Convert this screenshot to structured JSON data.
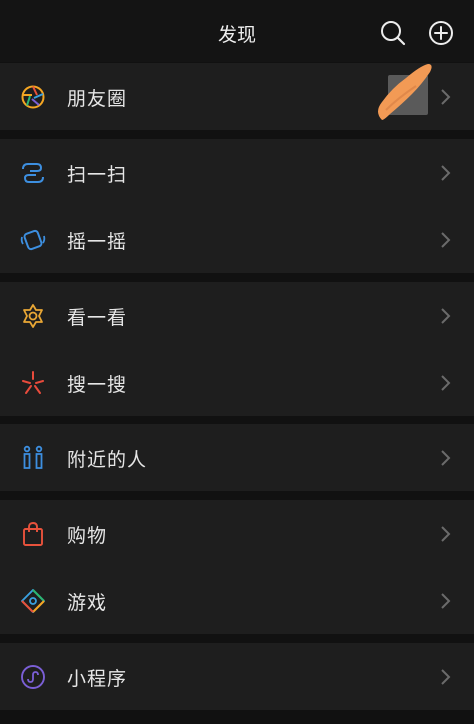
{
  "header": {
    "title": "发现",
    "search_icon": "search-icon",
    "add_icon": "plus-circle-icon"
  },
  "groups": [
    {
      "items": [
        {
          "label": "朋友圈",
          "icon": "moments-aperture-icon",
          "color": "#f5a623"
        }
      ]
    },
    {
      "items": [
        {
          "label": "扫一扫",
          "icon": "scan-icon",
          "color": "#3d8fe0"
        },
        {
          "label": "摇一摇",
          "icon": "shake-phone-icon",
          "color": "#3d8fe0"
        }
      ]
    },
    {
      "items": [
        {
          "label": "看一看",
          "icon": "top-stories-icon",
          "color": "#e9a735"
        },
        {
          "label": "搜一搜",
          "icon": "search-star-icon",
          "color": "#e84b3c"
        }
      ]
    },
    {
      "items": [
        {
          "label": "附近的人",
          "icon": "people-nearby-icon",
          "color": "#3d8fe0"
        }
      ]
    },
    {
      "items": [
        {
          "label": "购物",
          "icon": "shopping-bag-icon",
          "color": "#e8523c"
        },
        {
          "label": "游戏",
          "icon": "games-icon",
          "color": "#3aa1e0"
        }
      ]
    },
    {
      "items": [
        {
          "label": "小程序",
          "icon": "mini-programs-icon",
          "color": "#7b5fd6"
        }
      ]
    }
  ],
  "colors": {
    "background": "#111111",
    "row_background": "#1e1e1e",
    "text": "#e6e6e6",
    "chevron": "#6b6b6b",
    "scribble": "#f29a55"
  }
}
